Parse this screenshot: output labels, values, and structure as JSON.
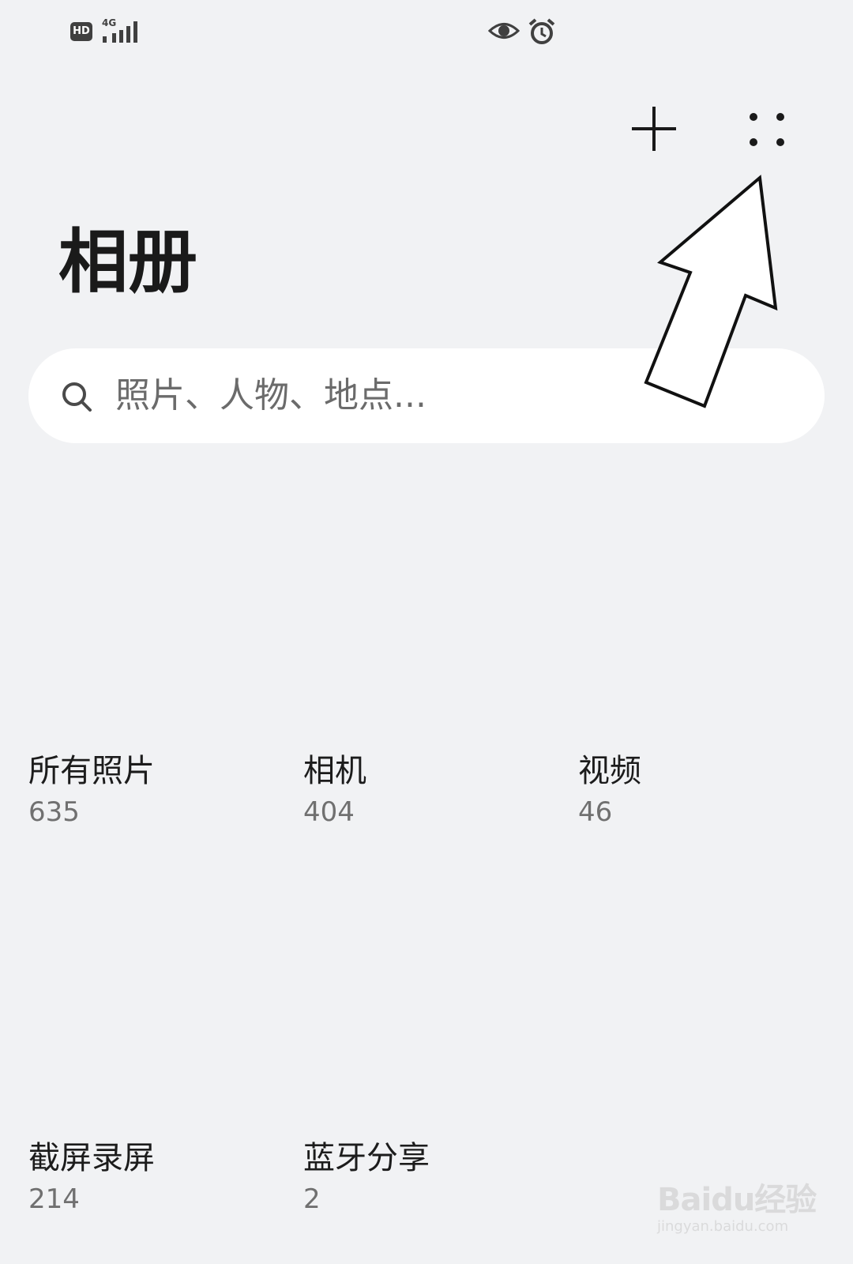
{
  "status_bar": {
    "hd_label": "HD",
    "network_label": "4G",
    "icons": [
      "signal-icon",
      "eye-icon",
      "alarm-icon"
    ]
  },
  "header": {
    "title": "相册",
    "actions": [
      {
        "name": "add-button",
        "icon": "plus-icon"
      },
      {
        "name": "more-button",
        "icon": "four-dots-icon"
      }
    ]
  },
  "search": {
    "placeholder": "照片、人物、地点..."
  },
  "albums": [
    {
      "name": "所有照片",
      "count": "635"
    },
    {
      "name": "相机",
      "count": "404"
    },
    {
      "name": "视频",
      "count": "46"
    },
    {
      "name": "截屏录屏",
      "count": "214"
    },
    {
      "name": "蓝牙分享",
      "count": "2"
    }
  ],
  "watermark": {
    "brand": "Baidu经验",
    "url": "jingyan.baidu.com"
  },
  "colors": {
    "background": "#f1f2f4",
    "search_bg": "#ffffff",
    "text_primary": "#1a1a1a",
    "text_secondary": "#707070"
  }
}
